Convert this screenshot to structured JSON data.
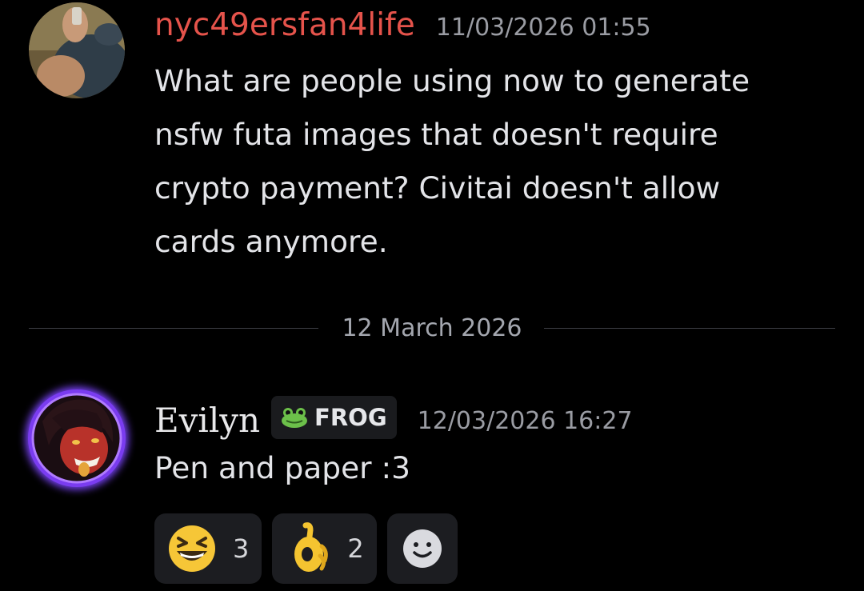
{
  "messages": [
    {
      "username": "nyc49ersfan4life",
      "username_color": "#e5534b",
      "timestamp": "11/03/2026 01:55",
      "lines": [
        "What are people using now to generate",
        "nsfw futa images that doesn't require",
        "crypto payment? Civitai doesn't allow",
        "cards anymore."
      ]
    },
    {
      "username": "Evilyn",
      "username_color": "#e8e8ea",
      "tag": {
        "label": "FROG",
        "icon": "frog-icon"
      },
      "timestamp": "12/03/2026 16:27",
      "text": "Pen and paper :3",
      "avatar_ring_color": "#9b4dff"
    }
  ],
  "divider": {
    "date": "12 March 2026"
  },
  "reactions": [
    {
      "emoji": "grinning-squinting-face-icon",
      "count": "3"
    },
    {
      "emoji": "ok-hand-icon",
      "count": "2"
    }
  ],
  "add_reaction": {
    "icon": "add-reaction-icon"
  }
}
